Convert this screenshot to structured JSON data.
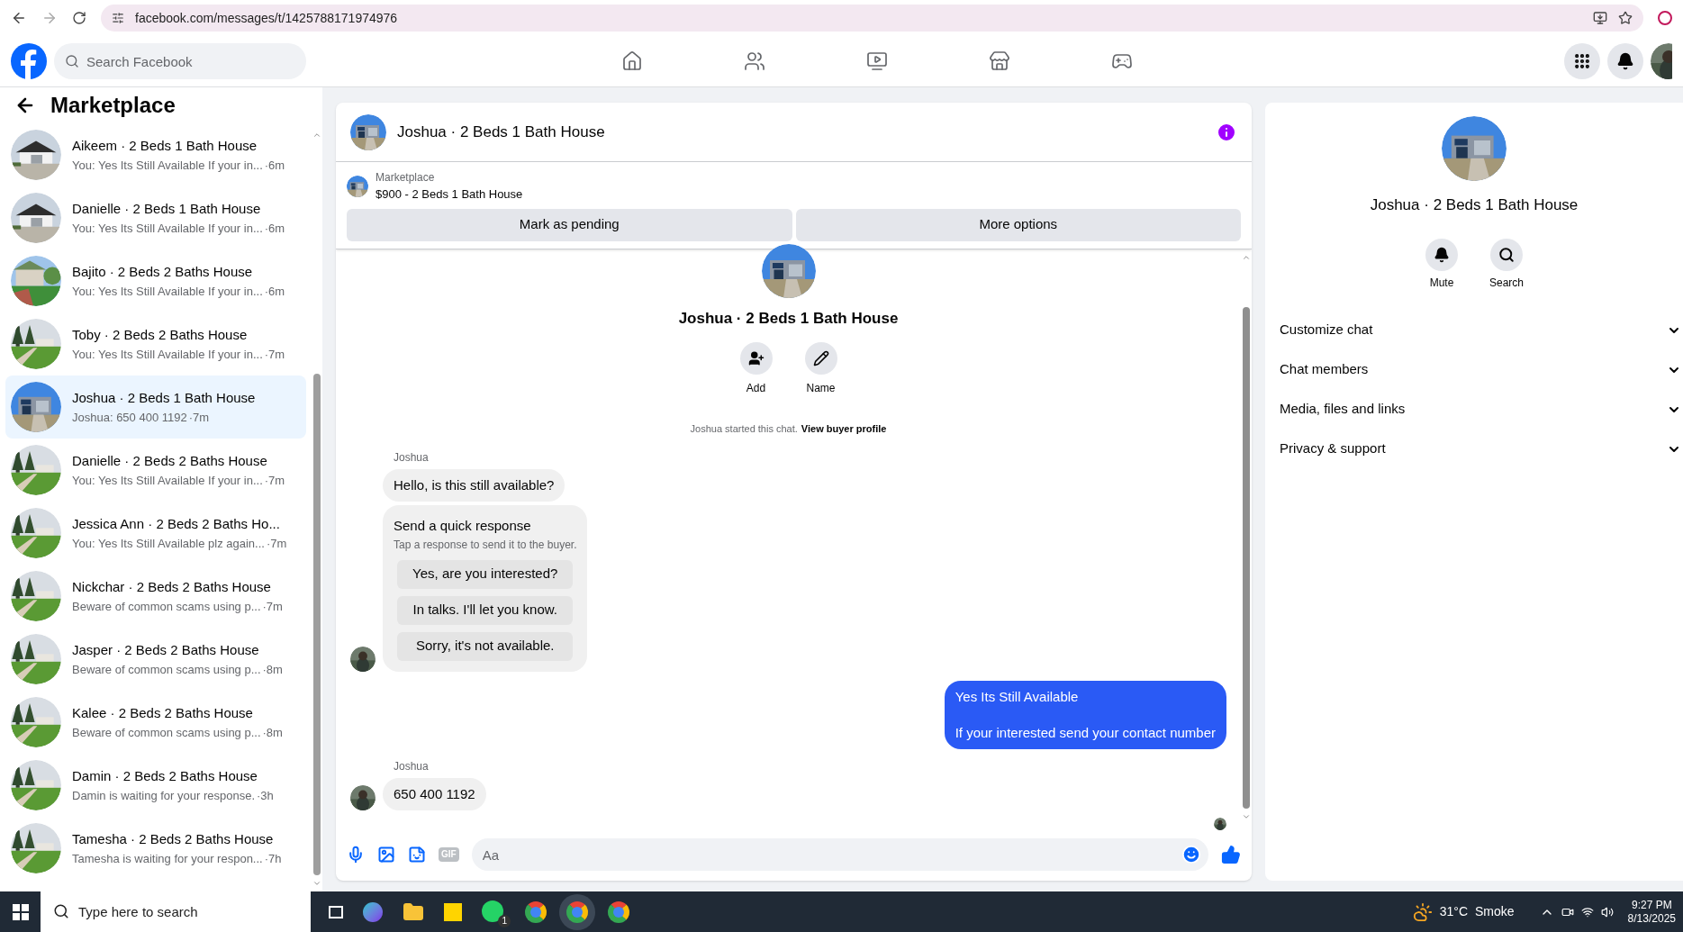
{
  "browser": {
    "url": "facebook.com/messages/t/1425788171974976"
  },
  "header": {
    "search_placeholder": "Search Facebook"
  },
  "sidebar": {
    "title": "Marketplace",
    "conversations": [
      {
        "title": "Aikeem · 2 Beds 1 Bath House",
        "preview": "You: Yes Its Still Available If your in...",
        "time": "·6m",
        "selected": false
      },
      {
        "title": "Danielle · 2 Beds 1 Bath House",
        "preview": "You: Yes Its Still Available If your in...",
        "time": "·6m",
        "selected": false
      },
      {
        "title": "Bajito · 2 Beds 2 Baths House",
        "preview": "You: Yes Its Still Available If your in...",
        "time": "·6m",
        "selected": false
      },
      {
        "title": "Toby · 2 Beds 2 Baths House",
        "preview": "You: Yes Its Still Available If your in...",
        "time": "·7m",
        "selected": false
      },
      {
        "title": "Joshua · 2 Beds 1 Bath House",
        "preview": "Joshua: 650 400 1192",
        "time": "·7m",
        "selected": true
      },
      {
        "title": "Danielle · 2 Beds 2 Baths House",
        "preview": "You: Yes Its Still Available If your in...",
        "time": "·7m",
        "selected": false
      },
      {
        "title": "Jessica Ann · 2 Beds 2 Baths Ho...",
        "preview": "You: Yes Its Still Available plz again...",
        "time": "·7m",
        "selected": false
      },
      {
        "title": "Nickchar · 2 Beds 2 Baths House",
        "preview": "Beware of common scams using p...",
        "time": "·7m",
        "selected": false
      },
      {
        "title": "Jasper · 2 Beds 2 Baths House",
        "preview": "Beware of common scams using p...",
        "time": "·8m",
        "selected": false
      },
      {
        "title": "Kalee · 2 Beds 2 Baths House",
        "preview": "Beware of common scams using p...",
        "time": "·8m",
        "selected": false
      },
      {
        "title": "Damin · 2 Beds 2 Baths House",
        "preview": "Damin is waiting for your response.",
        "time": "·3h",
        "selected": false
      },
      {
        "title": "Tamesha · 2 Beds 2 Baths House",
        "preview": "Tamesha is waiting for your respon...",
        "time": "·7h",
        "selected": false
      }
    ]
  },
  "chat": {
    "title": "Joshua · 2 Beds 1 Bath House",
    "listing": {
      "label": "Marketplace",
      "title": "$900 - 2 Beds 1 Bath House"
    },
    "actions": [
      "Mark as pending",
      "More options"
    ],
    "profile": {
      "name": "Joshua · 2 Beds 1 Bath House",
      "buttons": [
        {
          "kind": "add",
          "label": "Add"
        },
        {
          "kind": "name",
          "label": "Name"
        }
      ]
    },
    "system": {
      "text": "Joshua started this chat.",
      "link": "View buyer profile"
    },
    "groups": [
      {
        "kind": "incoming",
        "sender": "Joshua",
        "items": [
          {
            "kind": "text",
            "text": "Hello, is this still available?"
          },
          {
            "kind": "quick_response",
            "title": "Send a quick response",
            "subtitle": "Tap a response to send it to the buyer.",
            "options": [
              "Yes, are you interested?",
              "In talks. I'll let you know.",
              "Sorry, it's not available."
            ]
          }
        ]
      },
      {
        "kind": "outgoing",
        "items": [
          {
            "kind": "text",
            "text": "Yes Its Still Available\n\nIf your interested send your contact number"
          }
        ]
      },
      {
        "kind": "incoming",
        "sender": "Joshua",
        "items": [
          {
            "kind": "text",
            "text": "650 400 1192"
          }
        ]
      }
    ],
    "composer": {
      "placeholder": "Aa",
      "gif": "GIF"
    }
  },
  "details": {
    "name": "Joshua · 2 Beds 1 Bath House",
    "actions": [
      {
        "kind": "mute",
        "label": "Mute"
      },
      {
        "kind": "search",
        "label": "Search"
      }
    ],
    "sections": [
      {
        "label": "Customize chat",
        "expanded": false
      },
      {
        "label": "Chat members",
        "expanded": false
      },
      {
        "label": "Media, files and links",
        "expanded": false
      },
      {
        "label": "Privacy & support",
        "expanded": false
      }
    ]
  },
  "taskbar": {
    "search_placeholder": "Type here to search",
    "whatsapp_badge": "1",
    "temperature": "31°C",
    "condition": "Smoke",
    "time": "9:27 PM",
    "date": "8/13/2025"
  }
}
